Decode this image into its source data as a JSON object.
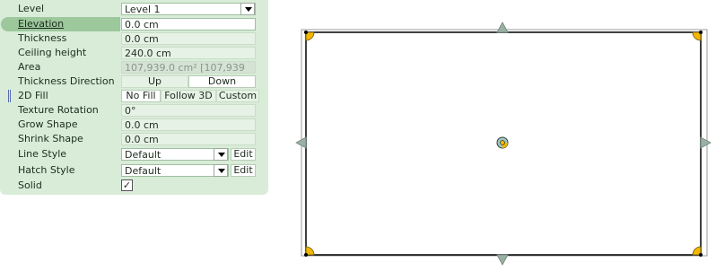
{
  "properties": {
    "level": {
      "label": "Level",
      "value": "Level 1"
    },
    "elevation": {
      "label": "Elevation",
      "value": "0.0 cm"
    },
    "thickness": {
      "label": "Thickness",
      "value": "0.0 cm"
    },
    "ceiling_height": {
      "label": "Ceiling height",
      "value": "240.0 cm"
    },
    "area": {
      "label": "Area",
      "value": "107,939.0 cm²  [107,939"
    },
    "thickness_direction": {
      "label": "Thickness Direction",
      "options": [
        "Up",
        "Down"
      ],
      "selected": "Down"
    },
    "fill_2d": {
      "label": "2D Fill",
      "options": [
        "No Fill",
        "Follow 3D",
        "Custom"
      ],
      "selected": "No Fill"
    },
    "texture_rotation": {
      "label": "Texture Rotation",
      "value": "0°"
    },
    "grow_shape": {
      "label": "Grow Shape",
      "value": "0.0 cm"
    },
    "shrink_shape": {
      "label": "Shrink Shape",
      "value": "0.0 cm"
    },
    "line_style": {
      "label": "Line Style",
      "value": "Default",
      "edit_label": "Edit"
    },
    "hatch_style": {
      "label": "Hatch Style",
      "value": "Default",
      "edit_label": "Edit"
    },
    "solid": {
      "label": "Solid",
      "checked": true,
      "check_glyph": "✓"
    }
  },
  "colors": {
    "panel_bg": "#d8ecd8",
    "highlight": "#9cc89c",
    "handle_yellow": "#f2b800",
    "handle_grey": "#9bb0a4"
  },
  "icons": [
    "dropdown-arrow-icon",
    "checkbox-check-icon",
    "resize-handle-icon",
    "rotate-handle-icon"
  ]
}
